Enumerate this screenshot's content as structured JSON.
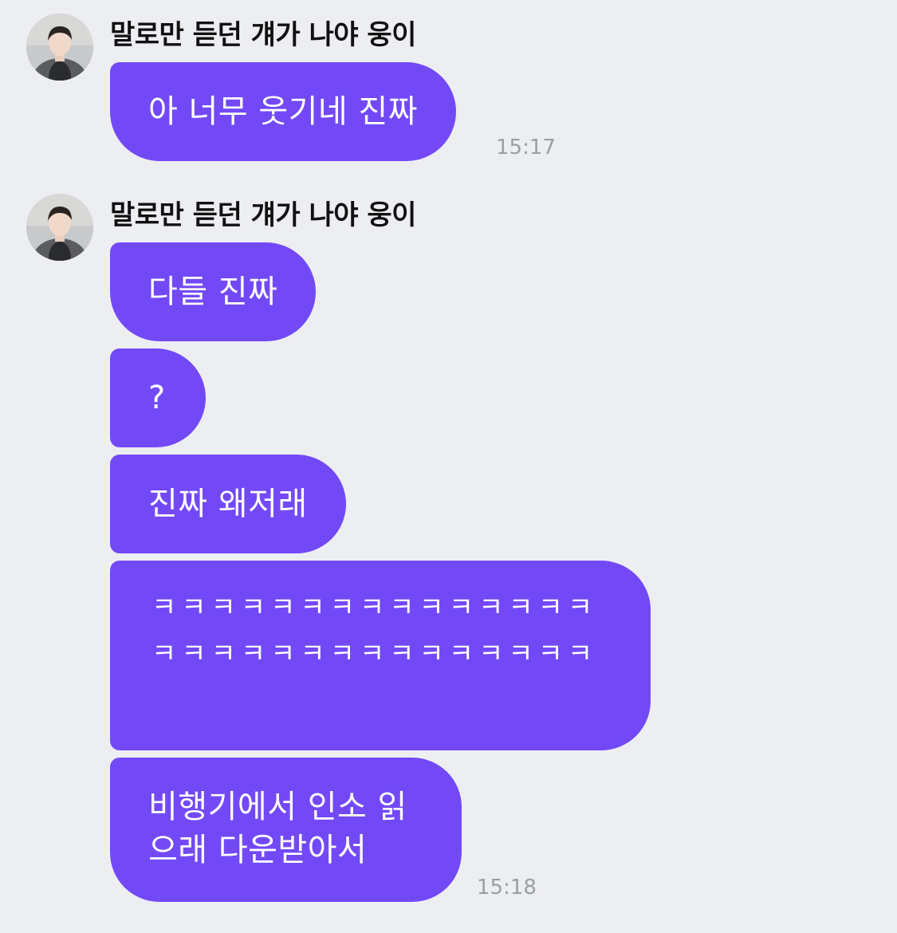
{
  "chat": {
    "groups": [
      {
        "sender": "말로만 듣던 걔가 나야 웅이",
        "messages": [
          "아 너무 웃기네 진짜"
        ],
        "time": "15:17"
      },
      {
        "sender": "말로만 듣던 걔가 나야 웅이",
        "messages": [
          "다들 진짜",
          "?",
          "진짜 왜저래",
          "ㅋㅋㅋㅋㅋㅋㅋㅋㅋㅋㅋㅋㅋㅋㅋㅋㅋㅋㅋㅋㅋㅋㅋㅋㅋㅋㅋㅋㅋㅋ",
          "비행기에서 인소 읽으래 다운받아서"
        ],
        "time": "15:18"
      }
    ]
  },
  "colors": {
    "background": "#edeef2",
    "bubble": "#7349f7",
    "bubble_text": "#ffffff",
    "sender_text": "#111111",
    "time_text": "#9b9ea5"
  },
  "icons": {
    "avatar": "profile-photo"
  }
}
